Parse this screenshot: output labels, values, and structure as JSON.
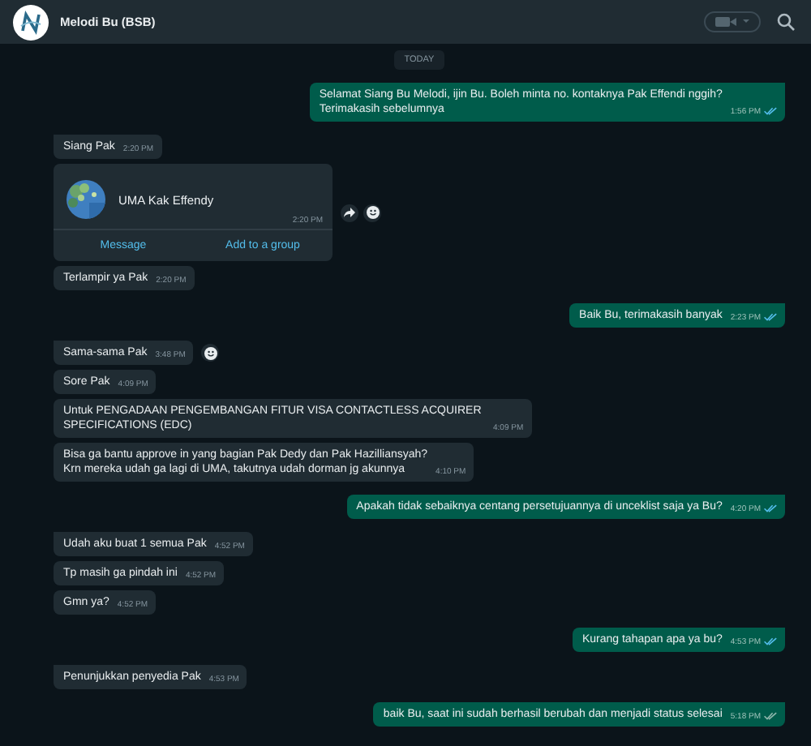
{
  "chat": {
    "title": "Melodi Bu (BSB)"
  },
  "date_divider": "TODAY",
  "messages": [
    {
      "kind": "outgoing",
      "text": "Selamat Siang Bu Melodi, ijin Bu. Boleh minta no. kontaknya Pak Effendi nggih?\nTerimakasih sebelumnya",
      "time": "1:56 PM",
      "read": true,
      "forward_button": false,
      "react_button": false
    },
    {
      "kind": "incoming",
      "text": "Siang Pak",
      "time": "2:20 PM",
      "forward_button": false,
      "react_button": false
    },
    {
      "kind": "contact",
      "name": "UMA Kak Effendy",
      "time": "2:20 PM",
      "actions": [
        "Message",
        "Add to a group"
      ],
      "forward_button": true,
      "react_button": true
    },
    {
      "kind": "incoming",
      "text": "Terlampir ya Pak",
      "time": "2:20 PM",
      "forward_button": false,
      "react_button": false
    },
    {
      "kind": "outgoing",
      "text": "Baik Bu, terimakasih banyak",
      "time": "2:23 PM",
      "read": true,
      "forward_button": false,
      "react_button": false
    },
    {
      "kind": "incoming",
      "text": "Sama-sama Pak",
      "time": "3:48 PM",
      "forward_button": false,
      "react_button": true
    },
    {
      "kind": "incoming",
      "text": "Sore Pak",
      "time": "4:09 PM",
      "forward_button": false,
      "react_button": false
    },
    {
      "kind": "incoming",
      "text": "Untuk PENGADAAN PENGEMBANGAN FITUR VISA CONTACTLESS ACQUIRER SPECIFICATIONS (EDC)",
      "time": "4:09 PM",
      "forward_button": false,
      "react_button": false
    },
    {
      "kind": "incoming",
      "text": "Bisa ga bantu approve in yang bagian Pak Dedy dan Pak Hazilliansyah?\nKrn mereka udah ga lagi di UMA, takutnya udah dorman jg akunnya",
      "time": "4:10 PM",
      "forward_button": false,
      "react_button": false
    },
    {
      "kind": "outgoing",
      "text": "Apakah tidak sebaiknya centang persetujuannya di unceklist saja ya Bu?",
      "time": "4:20 PM",
      "read": true,
      "forward_button": false,
      "react_button": false
    },
    {
      "kind": "incoming",
      "text": "Udah aku buat 1 semua Pak",
      "time": "4:52 PM",
      "forward_button": false,
      "react_button": false
    },
    {
      "kind": "incoming",
      "text": "Tp masih ga pindah ini",
      "time": "4:52 PM",
      "forward_button": false,
      "react_button": false
    },
    {
      "kind": "incoming",
      "text": "Gmn ya?",
      "time": "4:52 PM",
      "forward_button": false,
      "react_button": false
    },
    {
      "kind": "outgoing",
      "text": "Kurang tahapan apa ya bu?",
      "time": "4:53 PM",
      "read": true,
      "forward_button": false,
      "react_button": false
    },
    {
      "kind": "incoming",
      "text": "Penunjukkan penyedia Pak",
      "time": "4:53 PM",
      "forward_button": false,
      "react_button": false
    },
    {
      "kind": "outgoing",
      "text": "baik Bu, saat ini sudah berhasil berubah dan menjadi status selesai",
      "time": "5:18 PM",
      "read": false,
      "forward_button": false,
      "react_button": false
    }
  ]
}
